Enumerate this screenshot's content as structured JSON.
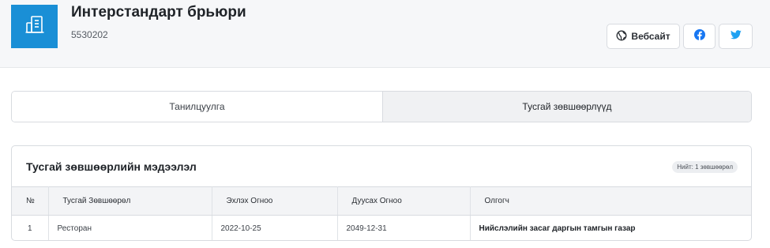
{
  "company": {
    "name": "Интерстандарт брьюри",
    "registration": "5530202"
  },
  "header_buttons": {
    "website_label": "Вебсайт"
  },
  "tabs": [
    {
      "label": "Танилцуулга",
      "active": false
    },
    {
      "label": "Тусгай зөвшөөрлүүд",
      "active": true
    }
  ],
  "license_section": {
    "title": "Тусгай зөвшөөрлийн мэдээлэл",
    "count_badge": "Нийт: 1 зөвшөөрөл",
    "columns": [
      "№",
      "Тусгай Зөвшөөрөл",
      "Эхлэх Огноо",
      "Дуусах Огноо",
      "Олгогч"
    ],
    "rows": [
      {
        "no": "1",
        "type": "Ресторан",
        "start": "2022-10-25",
        "end": "2049-12-31",
        "issuer": "Нийслэлийн засаг даргын тамгын газар"
      }
    ]
  },
  "icons": {
    "logo": "building-icon",
    "website": "globe-icon",
    "facebook": "facebook-icon",
    "twitter": "twitter-icon"
  },
  "colors": {
    "brand": "#1a8fd6",
    "facebook": "#1877f2",
    "twitter": "#1da1f2"
  }
}
